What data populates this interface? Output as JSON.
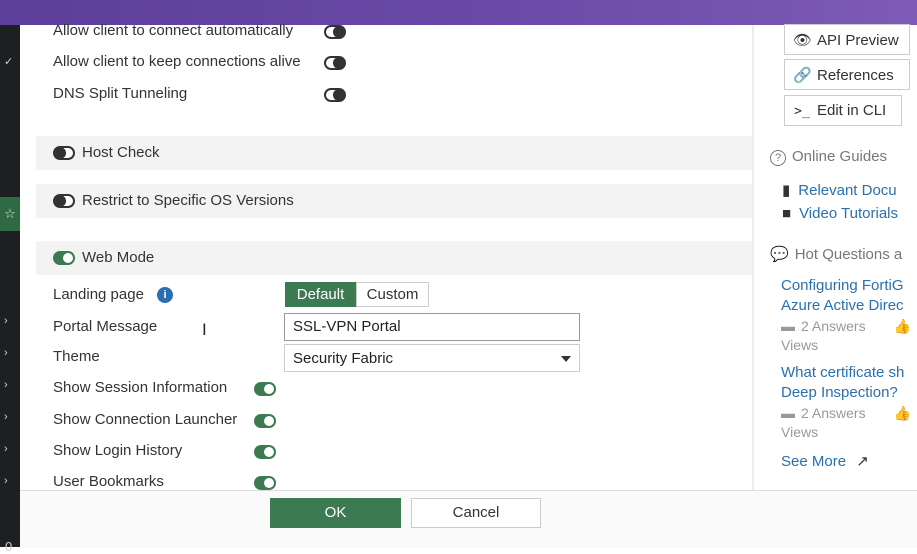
{
  "left_strip": {
    "star_icon": "star-icon",
    "bottom_char": "0"
  },
  "settings": {
    "allow_connect_auto": "Allow client to connect automatically",
    "allow_keep_alive": "Allow client to keep connections alive",
    "dns_split": "DNS Split Tunneling",
    "host_check": "Host Check",
    "restrict_os": "Restrict to Specific OS Versions",
    "web_mode": "Web Mode"
  },
  "web_mode": {
    "landing_page_label": "Landing page",
    "landing_default": "Default",
    "landing_custom": "Custom",
    "portal_message_label": "Portal Message",
    "portal_message_value": "SSL-VPN Portal",
    "theme_label": "Theme",
    "theme_value": "Security Fabric",
    "show_session_info": "Show Session Information",
    "show_connection_launcher": "Show Connection Launcher",
    "show_login_history": "Show Login History",
    "user_bookmarks": "User Bookmarks"
  },
  "footer": {
    "ok": "OK",
    "cancel": "Cancel"
  },
  "right_panel": {
    "api_preview": "API Preview",
    "references": "References",
    "edit_in_cli": "Edit in CLI",
    "online_guides": "Online Guides",
    "relevant_docs": "Relevant Docu",
    "video_tutorials": "Video Tutorials",
    "hot_questions": "Hot Questions a",
    "q1_line1": "Configuring FortiG",
    "q1_line2": "Azure Active Direc",
    "q1_answers": "2 Answers",
    "q1_views": "Views",
    "q2_line1": "What certificate sh",
    "q2_line2": "Deep Inspection?",
    "q2_answers": "2 Answers",
    "q2_views": "Views",
    "see_more": "See More"
  },
  "colors": {
    "accent_green": "#3c7a52",
    "top_bar": "#6a4aa8",
    "link_blue": "#2a6fb0"
  }
}
